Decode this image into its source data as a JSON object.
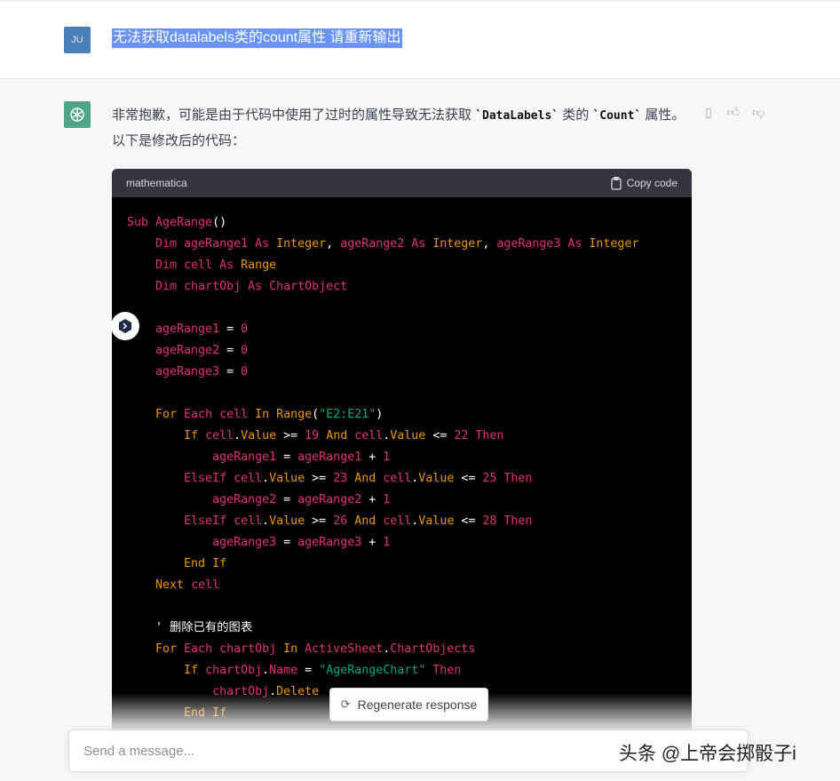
{
  "user": {
    "avatar": "JU",
    "message": "无法获取datalabels类的count属性 请重新输出"
  },
  "assistant": {
    "text_before": "非常抱歉，可能是由于代码中使用了过时的属性导致无法获取 ",
    "code1": "`DataLabels`",
    "text_mid": " 类的 ",
    "code2": "`Count`",
    "text_after": " 属性。以下是修改后的代码：",
    "actions": [
      "copy-icon",
      "thumbs-up-icon",
      "thumbs-down-icon"
    ]
  },
  "code_block": {
    "language": "mathematica",
    "copy_label": "Copy code",
    "colors": {
      "keyword": "#df3079",
      "type": "#e9950c",
      "string": "#00a67d"
    },
    "lines": [
      [
        [
          "k",
          "Sub AgeRange"
        ],
        [
          "p",
          "()"
        ]
      ],
      [
        [
          "k",
          "    Dim ageRange1 As "
        ],
        [
          "t",
          "Integer"
        ],
        [
          "p",
          ", "
        ],
        [
          "k",
          "ageRange2 As "
        ],
        [
          "t",
          "Integer"
        ],
        [
          "p",
          ", "
        ],
        [
          "k",
          "ageRange3 As "
        ],
        [
          "t",
          "Integer"
        ]
      ],
      [
        [
          "k",
          "    Dim cell As "
        ],
        [
          "t",
          "Range"
        ]
      ],
      [
        [
          "k",
          "    Dim chartObj As ChartObject"
        ]
      ],
      [],
      [
        [
          "k",
          "    ageRange1"
        ],
        [
          "p",
          " = "
        ],
        [
          "k",
          "0"
        ]
      ],
      [
        [
          "k",
          "    ageRange2"
        ],
        [
          "p",
          " = "
        ],
        [
          "k",
          "0"
        ]
      ],
      [
        [
          "k",
          "    ageRange3"
        ],
        [
          "p",
          " = "
        ],
        [
          "k",
          "0"
        ]
      ],
      [],
      [
        [
          "t",
          "    For "
        ],
        [
          "k",
          "Each cell "
        ],
        [
          "t",
          "In Range"
        ],
        [
          "p",
          "("
        ],
        [
          "s",
          "\"E2:E21\""
        ],
        [
          "p",
          ")"
        ]
      ],
      [
        [
          "t",
          "        If "
        ],
        [
          "k",
          "cell"
        ],
        [
          "p",
          "."
        ],
        [
          "t",
          "Value"
        ],
        [
          "p",
          " >= "
        ],
        [
          "k",
          "19 "
        ],
        [
          "t",
          "And "
        ],
        [
          "k",
          "cell"
        ],
        [
          "p",
          "."
        ],
        [
          "t",
          "Value"
        ],
        [
          "p",
          " <= "
        ],
        [
          "k",
          "22 Then"
        ]
      ],
      [
        [
          "k",
          "            ageRange1"
        ],
        [
          "p",
          " = "
        ],
        [
          "k",
          "ageRange1"
        ],
        [
          "p",
          " + "
        ],
        [
          "k",
          "1"
        ]
      ],
      [
        [
          "k",
          "        ElseIf cell"
        ],
        [
          "p",
          "."
        ],
        [
          "t",
          "Value"
        ],
        [
          "p",
          " >= "
        ],
        [
          "k",
          "23 "
        ],
        [
          "t",
          "And "
        ],
        [
          "k",
          "cell"
        ],
        [
          "p",
          "."
        ],
        [
          "t",
          "Value"
        ],
        [
          "p",
          " <= "
        ],
        [
          "k",
          "25 Then"
        ]
      ],
      [
        [
          "k",
          "            ageRange2"
        ],
        [
          "p",
          " = "
        ],
        [
          "k",
          "ageRange2"
        ],
        [
          "p",
          " + "
        ],
        [
          "k",
          "1"
        ]
      ],
      [
        [
          "k",
          "        ElseIf cell"
        ],
        [
          "p",
          "."
        ],
        [
          "t",
          "Value"
        ],
        [
          "p",
          " >= "
        ],
        [
          "k",
          "26 "
        ],
        [
          "t",
          "And "
        ],
        [
          "k",
          "cell"
        ],
        [
          "p",
          "."
        ],
        [
          "t",
          "Value"
        ],
        [
          "p",
          " <= "
        ],
        [
          "k",
          "28 Then"
        ]
      ],
      [
        [
          "k",
          "            ageRange3"
        ],
        [
          "p",
          " = "
        ],
        [
          "k",
          "ageRange3"
        ],
        [
          "p",
          " + "
        ],
        [
          "k",
          "1"
        ]
      ],
      [
        [
          "t",
          "        End If"
        ]
      ],
      [
        [
          "t",
          "    Next "
        ],
        [
          "k",
          "cell"
        ]
      ],
      [],
      [
        [
          "p",
          "    ' 删除已有的图表"
        ]
      ],
      [
        [
          "t",
          "    For "
        ],
        [
          "k",
          "Each chartObj "
        ],
        [
          "t",
          "In "
        ],
        [
          "k",
          "ActiveSheet"
        ],
        [
          "p",
          "."
        ],
        [
          "k",
          "ChartObjects"
        ]
      ],
      [
        [
          "t",
          "        If "
        ],
        [
          "k",
          "chartObj"
        ],
        [
          "p",
          "."
        ],
        [
          "k",
          "Name"
        ],
        [
          "p",
          " = "
        ],
        [
          "s",
          "\"AgeRangeChart\""
        ],
        [
          "k",
          " Then"
        ]
      ],
      [
        [
          "k",
          "            chartObj"
        ],
        [
          "p",
          "."
        ],
        [
          "t",
          "Delete"
        ]
      ],
      [
        [
          "t",
          "        End If"
        ]
      ]
    ]
  },
  "regenerate_label": "Regenerate response",
  "input_placeholder": "Send a message...",
  "watermark": "头条 @上帝会掷骰子i"
}
